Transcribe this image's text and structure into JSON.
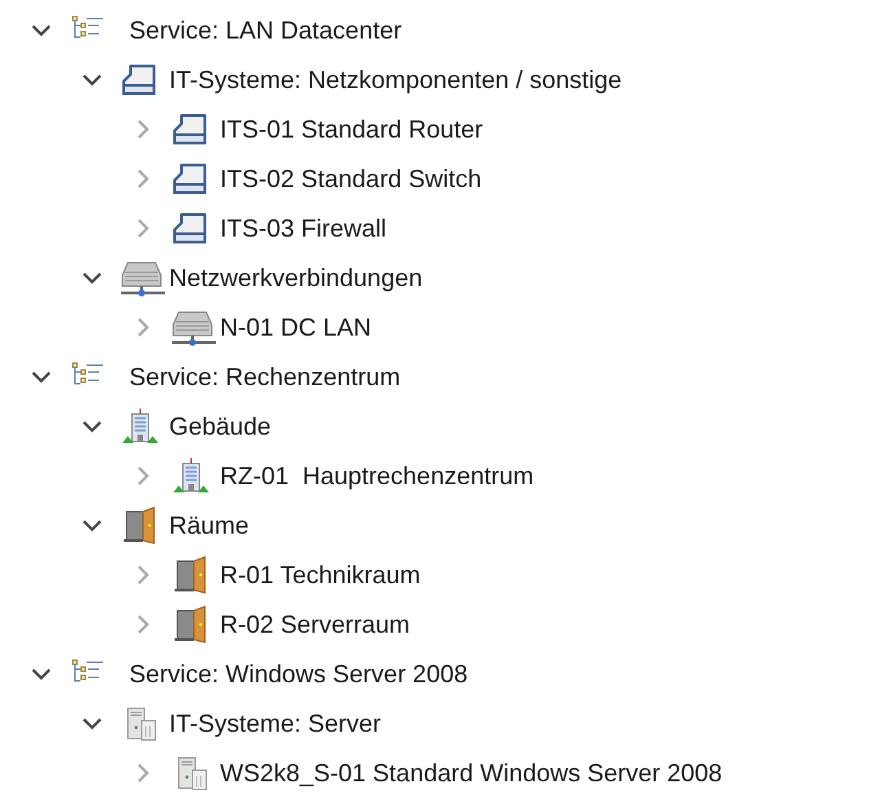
{
  "tree": [
    {
      "label": "Service: LAN Datacenter",
      "kind": "service",
      "expanded": true,
      "children": [
        {
          "label": "IT-Systeme: Netzkomponenten / sonstige",
          "kind": "system",
          "expanded": true,
          "children": [
            {
              "label": "ITS-01 Standard Router",
              "kind": "system",
              "expanded": false
            },
            {
              "label": "ITS-02 Standard Switch",
              "kind": "system",
              "expanded": false
            },
            {
              "label": "ITS-03 Firewall",
              "kind": "system",
              "expanded": false
            }
          ]
        },
        {
          "label": "Netzwerkverbindungen",
          "kind": "network",
          "expanded": true,
          "children": [
            {
              "label": "N-01 DC LAN",
              "kind": "network",
              "expanded": false
            }
          ]
        }
      ]
    },
    {
      "label": "Service: Rechenzentrum",
      "kind": "service",
      "expanded": true,
      "children": [
        {
          "label": "Gebäude",
          "kind": "building",
          "expanded": true,
          "children": [
            {
              "label": "RZ-01  Hauptrechenzentrum",
              "kind": "building",
              "expanded": false
            }
          ]
        },
        {
          "label": "Räume",
          "kind": "room",
          "expanded": true,
          "children": [
            {
              "label": "R-01 Technikraum",
              "kind": "room",
              "expanded": false
            },
            {
              "label": "R-02 Serverraum",
              "kind": "room",
              "expanded": false
            }
          ]
        }
      ]
    },
    {
      "label": "Service: Windows Server 2008",
      "kind": "service",
      "expanded": true,
      "children": [
        {
          "label": "IT-Systeme: Server",
          "kind": "server",
          "expanded": true,
          "children": [
            {
              "label": "WS2k8_S-01 Standard Windows Server 2008",
              "kind": "server",
              "expanded": false
            }
          ]
        }
      ]
    }
  ]
}
